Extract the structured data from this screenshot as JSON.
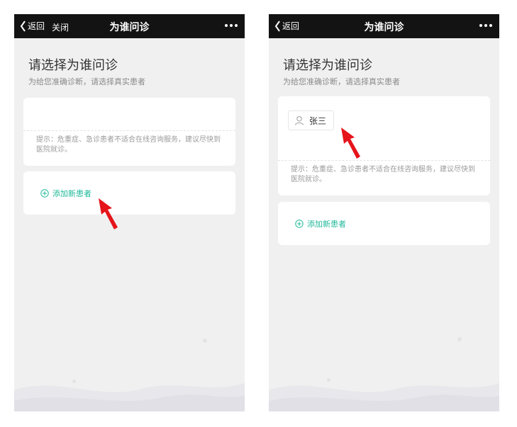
{
  "left": {
    "nav": {
      "back_label": "返回",
      "close_label": "关闭",
      "title": "为谁问诊"
    },
    "heading": "请选择为谁问诊",
    "subtitle": "为给您准确诊断，请选择真实患者",
    "tip": "提示：危重症、急诊患者不适合在线咨询服务，建议尽快到医院就诊。",
    "add_patient_label": "添加新患者"
  },
  "right": {
    "nav": {
      "back_label": "返回",
      "title": "为谁问诊"
    },
    "heading": "请选择为谁问诊",
    "subtitle": "为给您准确诊断，请选择真实患者",
    "patients": [
      {
        "name": "张三"
      }
    ],
    "tip": "提示：危重症、急诊患者不适合在线咨询服务，建议尽快到医院就诊。",
    "add_patient_label": "添加新患者"
  },
  "colors": {
    "navbar": "#131313",
    "accent_green": "#1fb89a",
    "annotation_arrow": "#e5141b",
    "page_bg": "#f0f0f0"
  },
  "icons": [
    "back-chevron-icon",
    "more-dots-icon",
    "add-circle-icon",
    "person-outline-icon",
    "red-arrow-annotation"
  ]
}
